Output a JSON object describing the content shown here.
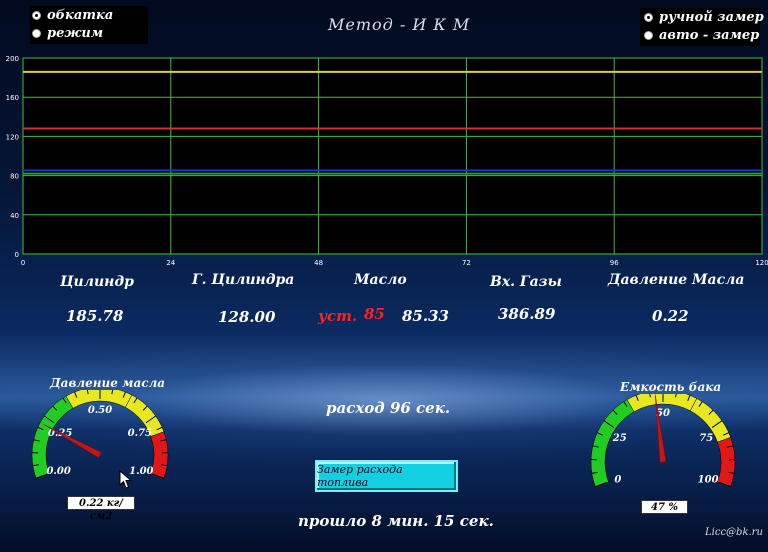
{
  "mode_group": {
    "options": [
      "обкатка",
      "режим"
    ],
    "selected": 0
  },
  "measure_group": {
    "options": [
      "ручной замер",
      "авто - замер"
    ],
    "selected": 0
  },
  "title": "Метод - И К М",
  "colors": {
    "grid": "#3fbf3f",
    "background": "#000000",
    "yellow": "#d8d040",
    "red": "#d83030",
    "blue": "#2030c8",
    "green": "#20a020"
  },
  "chart_data": {
    "type": "line",
    "xlim": [
      0,
      120
    ],
    "ylim": [
      0,
      200
    ],
    "x_ticks": [
      "0",
      "24",
      "48",
      "72",
      "96",
      "120"
    ],
    "y_ticks": [
      "0",
      "40",
      "80",
      "120",
      "160",
      "200"
    ],
    "grid": true,
    "series": [
      {
        "color": "#d8d040",
        "x": [
          0,
          120
        ],
        "y": [
          185.78,
          185.78
        ]
      },
      {
        "color": "#d83030",
        "x": [
          0,
          120
        ],
        "y": [
          128.0,
          128.0
        ]
      },
      {
        "color": "#2030c8",
        "x": [
          0,
          120
        ],
        "y": [
          85.33,
          85.33
        ]
      },
      {
        "color": "#20a020",
        "x": [
          0,
          120
        ],
        "y": [
          82.0,
          82.0
        ]
      }
    ]
  },
  "readings": {
    "cyl_label": "Цилиндр",
    "cyl_value": "185.78",
    "gcyl_label": "Г. Цилиндра",
    "gcyl_value": "128.00",
    "oil_label": "Масло",
    "oil_set_label": "уст.",
    "oil_set_value": "85",
    "oil_value": "85.33",
    "exh_label": "Вх. Газы",
    "exh_value": "386.89",
    "press_label": "Давление Масла",
    "press_value": "0.22"
  },
  "flow_text": "расход  96 сек.",
  "measure_button": "Замер расхода топлива",
  "elapsed_text": "прошло  8 мин.  15 сек.",
  "gauge_oil": {
    "title": "Давление масла",
    "ticks": [
      "0.00",
      "0.25",
      "0.50",
      "0.75",
      "1.00"
    ],
    "min": 0,
    "max": 1,
    "value": 0.22,
    "readout": "0.22 кг/см2"
  },
  "gauge_tank": {
    "title": "Емкость бака",
    "ticks": [
      "0",
      "25",
      "50",
      "75",
      "100"
    ],
    "min": 0,
    "max": 100,
    "value": 47,
    "readout": "47   %"
  },
  "footer_email": "Licc@bk.ru",
  "icons": {
    "cursor": "arrow-cursor-icon"
  }
}
